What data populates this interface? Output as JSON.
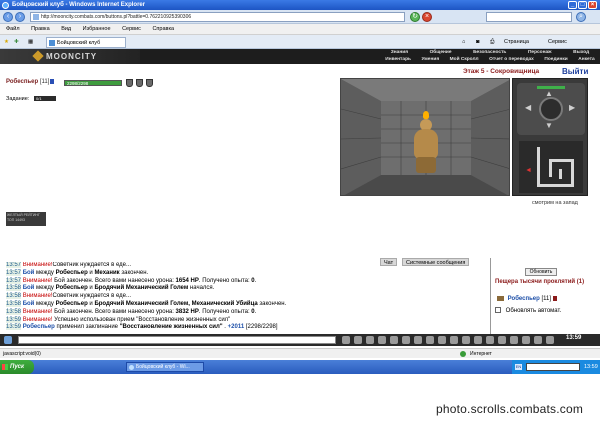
{
  "window": {
    "title": "Бойцовский клуб - Windows Internet Explorer",
    "url": "http://mooncity.combats.com/buttons.pl?battle=0.762210925390306",
    "menu": [
      "Файл",
      "Правка",
      "Вид",
      "Избранное",
      "Сервис",
      "Справка"
    ],
    "tab_title": "Бойцовский клуб",
    "toolbar_page": "Страница",
    "toolbar_tools": "Сервис"
  },
  "game": {
    "logo": "MOONCITY",
    "nav_top": [
      "Знания",
      "Общение",
      "Безопасность",
      "Персонаж",
      "Выход"
    ],
    "nav_bottom": [
      "Инвентарь",
      "Умения",
      "Мой Скролл",
      "Отчет о переводах",
      "Поединки",
      "Анкета"
    ],
    "player_name": "Робеспьер",
    "player_level": "[11]",
    "hp_text": "2298/2298",
    "hp_fraction": 1.0,
    "task_label": "Задание:",
    "task_value": "0/1",
    "ministats": "ЖЕЛТЫЙ РЕЙТИНГ  ТОП 14493",
    "floor_title": "Этаж 5 - Сокровищница",
    "exit_label": "Выйти",
    "look_direction": "смотрим на запад"
  },
  "chat": {
    "tabs": [
      "Чат",
      "Системные сообщения"
    ],
    "lines": [
      {
        "time": "13:57",
        "parts": [
          [
            "warn",
            "Внимание!"
          ],
          [
            "",
            "Советник нуждается в еде..."
          ]
        ]
      },
      {
        "time": "13:57",
        "parts": [
          [
            "ply",
            "Бой"
          ],
          [
            "",
            " между "
          ],
          [
            "b",
            "Робеспьер"
          ],
          [
            "",
            " и "
          ],
          [
            "b",
            "Механик"
          ],
          [
            "",
            " закончен."
          ]
        ]
      },
      {
        "time": "13:57",
        "parts": [
          [
            "warn",
            "Внимание!"
          ],
          [
            "",
            " Бой закончен. Всего вами нанесено урона: "
          ],
          [
            "b",
            "1654 HP"
          ],
          [
            "",
            ". Получено опыта: "
          ],
          [
            "b",
            "0"
          ],
          [
            "",
            "."
          ]
        ]
      },
      {
        "time": "13:58",
        "parts": [
          [
            "ply",
            "Бой"
          ],
          [
            "",
            " между "
          ],
          [
            "b",
            "Робеспьер"
          ],
          [
            "",
            " и "
          ],
          [
            "b",
            "Бродячий Механический Голем"
          ],
          [
            "",
            " начался."
          ]
        ]
      },
      {
        "time": "13:58",
        "parts": [
          [
            "warn",
            "Внимание!"
          ],
          [
            "",
            "Советник нуждается в еде..."
          ]
        ]
      },
      {
        "time": "13:58",
        "parts": [
          [
            "ply",
            "Бой"
          ],
          [
            "",
            " между "
          ],
          [
            "b",
            "Робеспьер"
          ],
          [
            "",
            " и "
          ],
          [
            "b",
            "Бродячий Механический Голем, Механический Убийца"
          ],
          [
            "",
            " закончен."
          ]
        ]
      },
      {
        "time": "13:58",
        "parts": [
          [
            "warn",
            "Внимание!"
          ],
          [
            "",
            " Бой закончен. Всего вами нанесено урона: "
          ],
          [
            "b",
            "3832 HP"
          ],
          [
            "",
            ". Получено опыта: "
          ],
          [
            "b",
            "0"
          ],
          [
            "",
            "."
          ]
        ]
      },
      {
        "time": "13:59",
        "parts": [
          [
            "warn",
            "Внимание!"
          ],
          [
            "",
            " Успешно использован прием \"Восстановление жизненных сил\""
          ]
        ]
      },
      {
        "time": "13:59",
        "parts": [
          [
            "ply",
            "Робеспьер"
          ],
          [
            "",
            " применил заклинание "
          ],
          [
            "b",
            "\"Восстановление жизненных сил\""
          ],
          [
            "",
            " . "
          ],
          [
            "ply",
            "+2011"
          ],
          [
            "",
            " [2298/2298]"
          ]
        ]
      }
    ]
  },
  "side": {
    "refresh_button": "Обновить",
    "cave_header": "Пещера тысячи проклятий (1)",
    "player": "Робеспьер",
    "player_level": "[11]",
    "auto_refresh": "Обновлять автомат."
  },
  "toolbar_clock": "13:59",
  "status": {
    "left": "javascript:void(0)",
    "zone": "Интернет"
  },
  "taskbar": {
    "start": "Пуск",
    "app": "Бойцовский клуб - Wi...",
    "clock": "13:59"
  },
  "watermark": "photo.scrolls.combats.com"
}
